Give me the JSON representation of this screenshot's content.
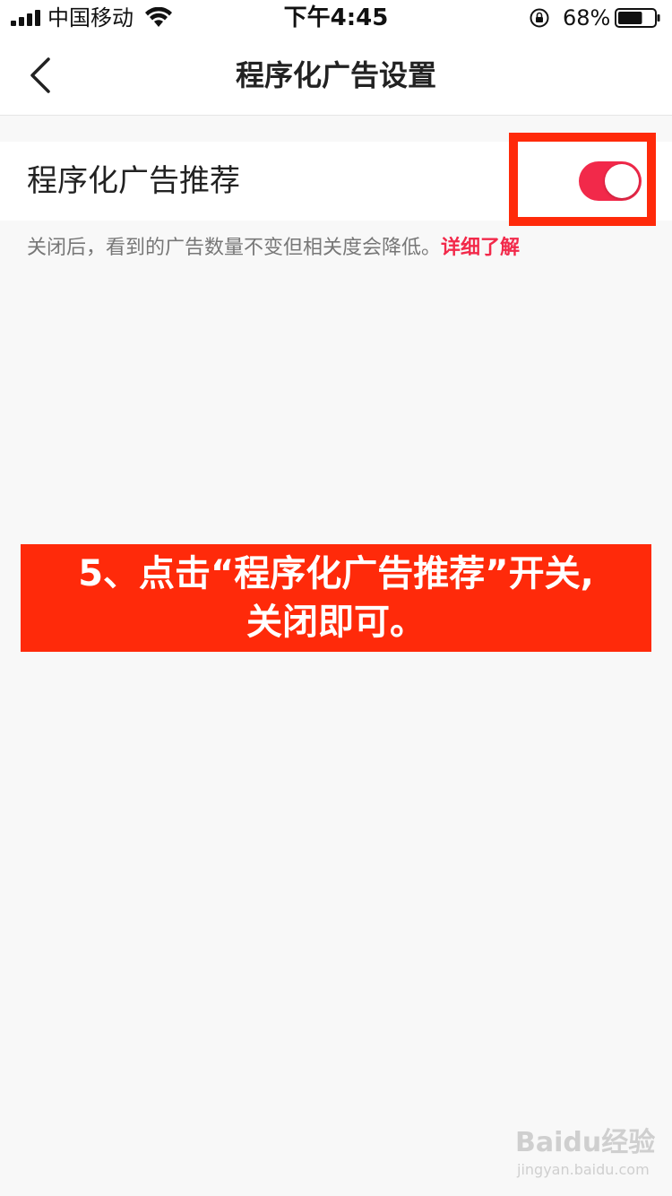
{
  "status_bar": {
    "carrier": "中国移动",
    "time": "下午4:45",
    "battery_percent": "68%",
    "battery_level": 0.68,
    "icons": [
      "signal-icon",
      "wifi-icon",
      "orientation-lock-icon",
      "battery-icon"
    ]
  },
  "nav": {
    "back_icon": "chevron-left-icon",
    "title": "程序化广告设置"
  },
  "setting": {
    "label": "程序化广告推荐",
    "toggle_on": true,
    "toggle_color": "#f2294a"
  },
  "hint": {
    "text": "关闭后，看到的广告数量不变但相关度会降低。",
    "link": "详细了解"
  },
  "banner": {
    "line1": "5、点击“程序化广告推荐”开关,",
    "line2": "关闭即可。",
    "color": "#ff2a0a"
  },
  "watermark": {
    "logo": "Baidu经验",
    "url": "jingyan.baidu.com"
  }
}
